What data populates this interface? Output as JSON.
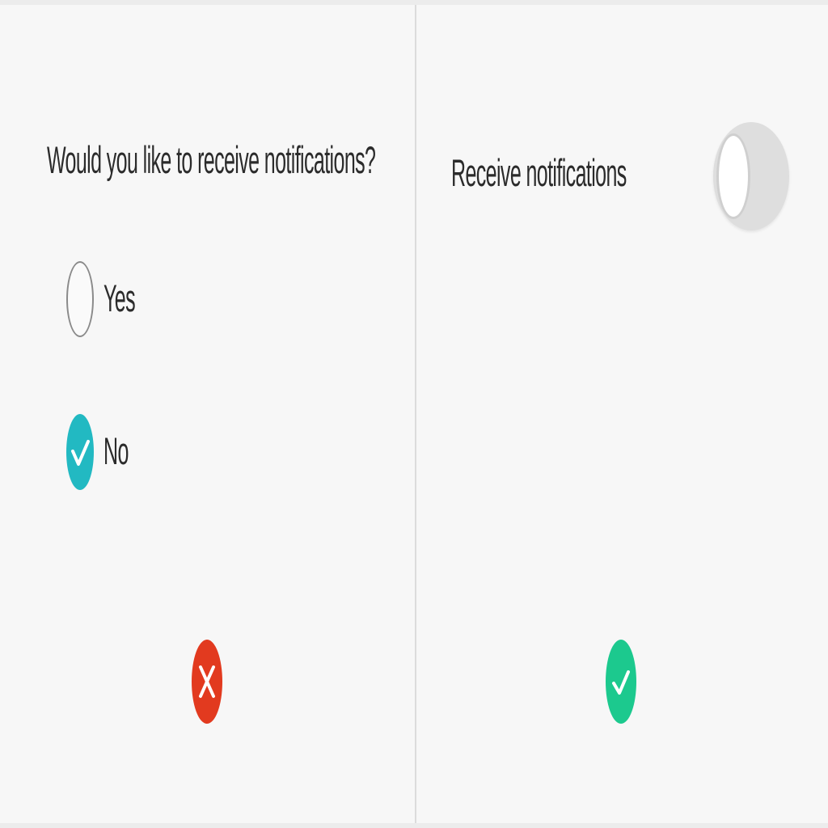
{
  "left_panel": {
    "question": "Would you like to receive notifications?",
    "options": [
      {
        "label": "Yes",
        "selected": false
      },
      {
        "label": "No",
        "selected": true
      }
    ],
    "indicator": {
      "icon": "x-icon",
      "color": "#e23a1f"
    },
    "accent": "#22b9c2"
  },
  "right_panel": {
    "toggle_label": "Receive notifications",
    "toggle_on": false,
    "indicator": {
      "icon": "check-icon",
      "color": "#1cc98e"
    }
  }
}
